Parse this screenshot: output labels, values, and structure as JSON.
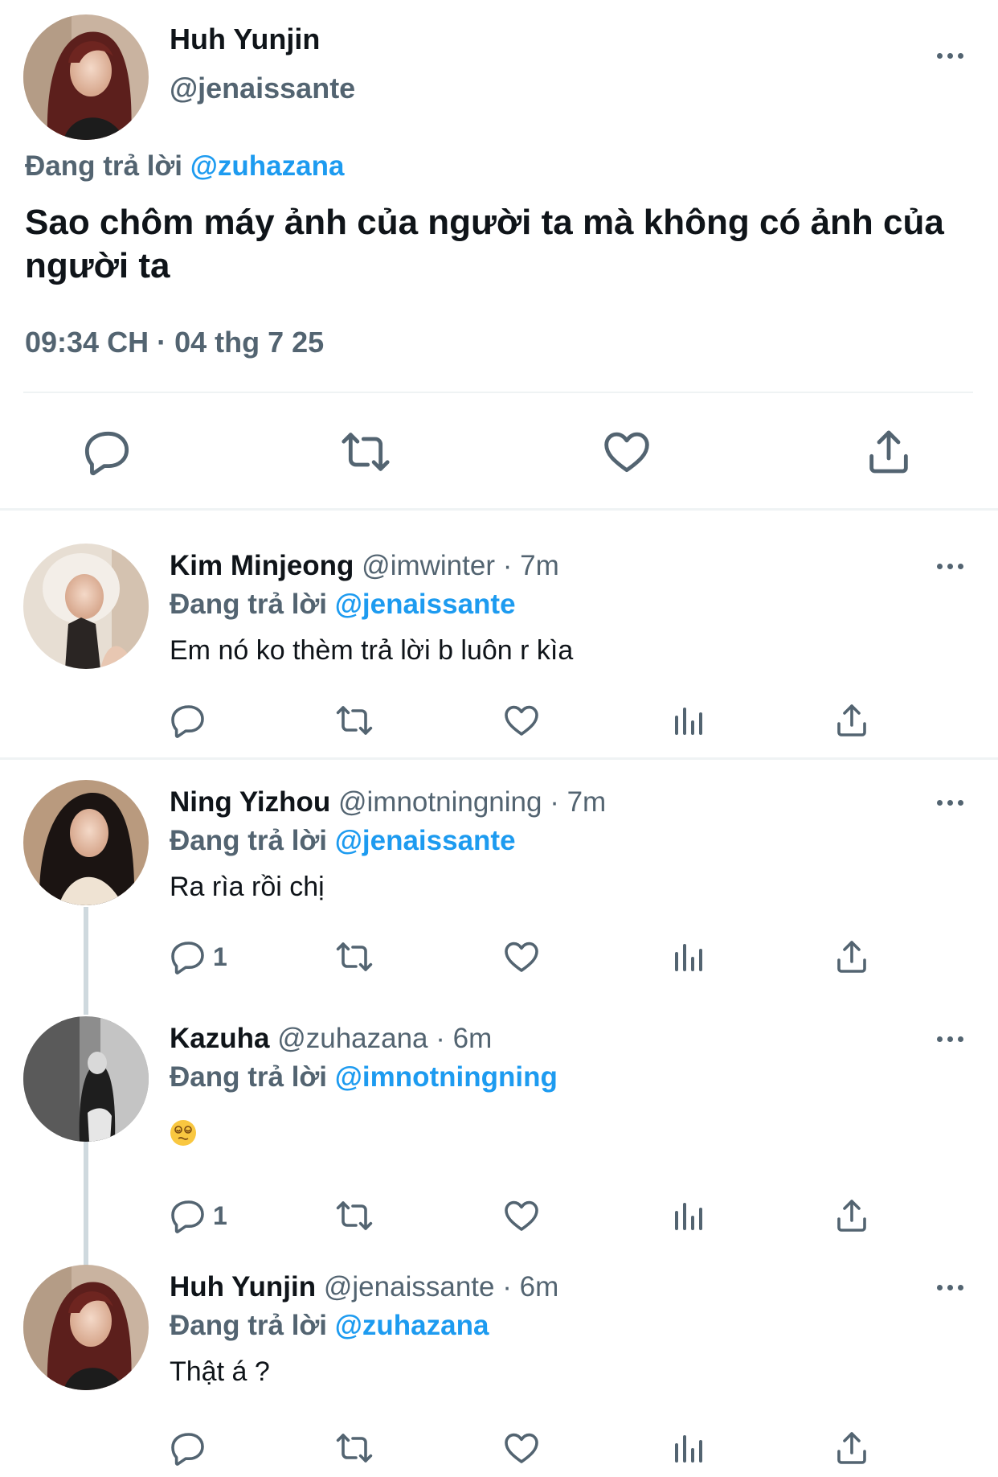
{
  "main_tweet": {
    "author_name": "Huh Yunjin",
    "author_handle": "@jenaissante",
    "replying_prefix": "Đang trả lời",
    "replying_to": "@zuhazana",
    "text": "Sao chôm máy ảnh của người ta mà không có ảnh của người ta",
    "timestamp": "09:34 CH · 04 thg 7 25",
    "actions": [
      "reply-icon",
      "retweet-icon",
      "like-icon",
      "share-icon"
    ]
  },
  "replies": [
    {
      "author_name": "Kim Minjeong",
      "author_handle": "@imwinter",
      "time": "· 7m",
      "replying_prefix": "Đang trả lời",
      "replying_to": "@jenaissante",
      "text": "Em nó ko thèm trả lời b luôn r kìa",
      "reply_count": ""
    },
    {
      "author_name": "Ning Yizhou",
      "author_handle": "@imnotningning",
      "time": "· 7m",
      "replying_prefix": "Đang trả lời",
      "replying_to": "@jenaissante",
      "text": "Ra rìa rồi chị",
      "reply_count": "1"
    },
    {
      "author_name": "Kazuha",
      "author_handle": "@zuhazana",
      "time": "· 6m",
      "replying_prefix": "Đang trả lời",
      "replying_to": "@imnotningning",
      "text": "",
      "emoji": "dizzy-face-emoji",
      "reply_count": "1"
    },
    {
      "author_name": "Huh Yunjin",
      "author_handle": "@jenaissante",
      "time": "· 6m",
      "replying_prefix": "Đang trả lời",
      "replying_to": "@zuhazana",
      "text": "Thật á ?",
      "reply_count": ""
    }
  ],
  "colors": {
    "accent": "#1d9bf0",
    "secondary_text": "#536471",
    "primary_text": "#0f1419",
    "divider": "#eff3f4",
    "thread_line": "#cfd9de"
  }
}
